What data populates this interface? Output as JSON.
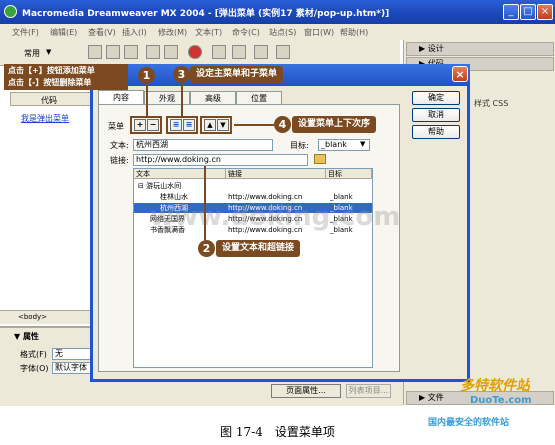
{
  "window": {
    "title": "Macromedia Dreamweaver MX 2004 - [弹出菜单 (实例17  素材/pop-up.htm*)]"
  },
  "menubar": [
    "文件(F)",
    "编辑(E)",
    "查看(V)",
    "插入(I)",
    "修改(M)",
    "文本(T)",
    "命令(C)",
    "站点(S)",
    "窗口(W)",
    "帮助(H)"
  ],
  "toolbar": {
    "category": "常用"
  },
  "right_panel": {
    "design": "▶ 设计",
    "code": "▶ 代码",
    "css": "样式 CSS",
    "files": "▶ 文件"
  },
  "doc": {
    "link_text": "我是弹出菜单",
    "tabs": "代码",
    "status": "<body>"
  },
  "props": {
    "title": "▼ 属性",
    "format_label": "格式(F)",
    "format_value": "无",
    "font_label": "字体(O)",
    "font_value": "默认字体",
    "page_props_button": "页面属性...",
    "list_button": "列表项目..."
  },
  "left_callout": {
    "line1": "点击【+】按钮添加菜单",
    "line2": "点击【-】按钮删除菜单"
  },
  "dialog": {
    "title_fragment": "单",
    "tabs": [
      "内容",
      "外观",
      "高级",
      "位置"
    ],
    "ok": "确定",
    "cancel": "取消",
    "help": "帮助",
    "menu_label": "菜单",
    "text_label": "文本:",
    "text_value": "杭州西湖",
    "target_label": "目标:",
    "target_value": "_blank",
    "link_label": "链接:",
    "link_value": "http://www.doking.cn",
    "list_headers": [
      "文本",
      "链接",
      "目标"
    ],
    "rows": [
      {
        "text": "⊟ 游玩山水间",
        "link": "",
        "target": ""
      },
      {
        "text": "桂林山水",
        "link": "http://www.doking.cn",
        "target": "_blank"
      },
      {
        "text": "杭州西湖",
        "link": "http://www.doking.cn",
        "target": "_blank"
      },
      {
        "text": "网络无国界",
        "link": "http://www.doking.cn",
        "target": "_blank"
      },
      {
        "text": "书香飘满香",
        "link": "http://www.doking.cn",
        "target": "_blank"
      }
    ]
  },
  "callouts": {
    "n1": "1",
    "n2": "2",
    "n3": "3",
    "n4": "4",
    "c2": "设置文本和超链接",
    "c3": "设定主菜单和子菜单",
    "c4": "设置菜单上下次序"
  },
  "watermark": "www.doking.com",
  "logo": {
    "text": "多特软件站",
    "url": "DuoTe.com",
    "sub": "国内最安全的软件站"
  },
  "caption": "图 17-4　设置菜单项",
  "colors": {
    "callout": "#7b4a20",
    "titlebar": "#1f52c9",
    "selection": "#316ac5"
  }
}
